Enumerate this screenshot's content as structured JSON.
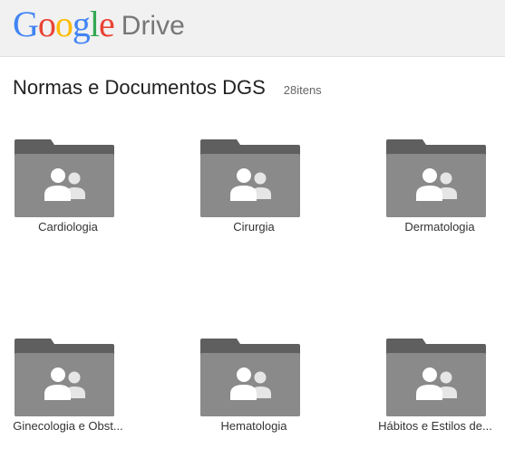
{
  "header": {
    "logo_letters": [
      "G",
      "o",
      "o",
      "g",
      "l",
      "e"
    ],
    "logo_product": "Drive"
  },
  "folder": {
    "title": "Normas e Documentos DGS",
    "item_count": "28itens"
  },
  "items": [
    {
      "label": "Cardiologia",
      "icon": "shared-folder-icon"
    },
    {
      "label": "Cirurgia",
      "icon": "shared-folder-icon"
    },
    {
      "label": "Dermatologia",
      "icon": "shared-folder-icon"
    },
    {
      "label": "Ginecologia e Obst...",
      "icon": "shared-folder-icon"
    },
    {
      "label": "Hematologia",
      "icon": "shared-folder-icon"
    },
    {
      "label": "Hábitos e Estilos de...",
      "icon": "shared-folder-icon"
    }
  ],
  "colors": {
    "folder_tab": "#5f5f5f",
    "folder_body": "#8a8a8a",
    "people_icon": "#ffffff",
    "header_bg": "#f1f1f1"
  }
}
